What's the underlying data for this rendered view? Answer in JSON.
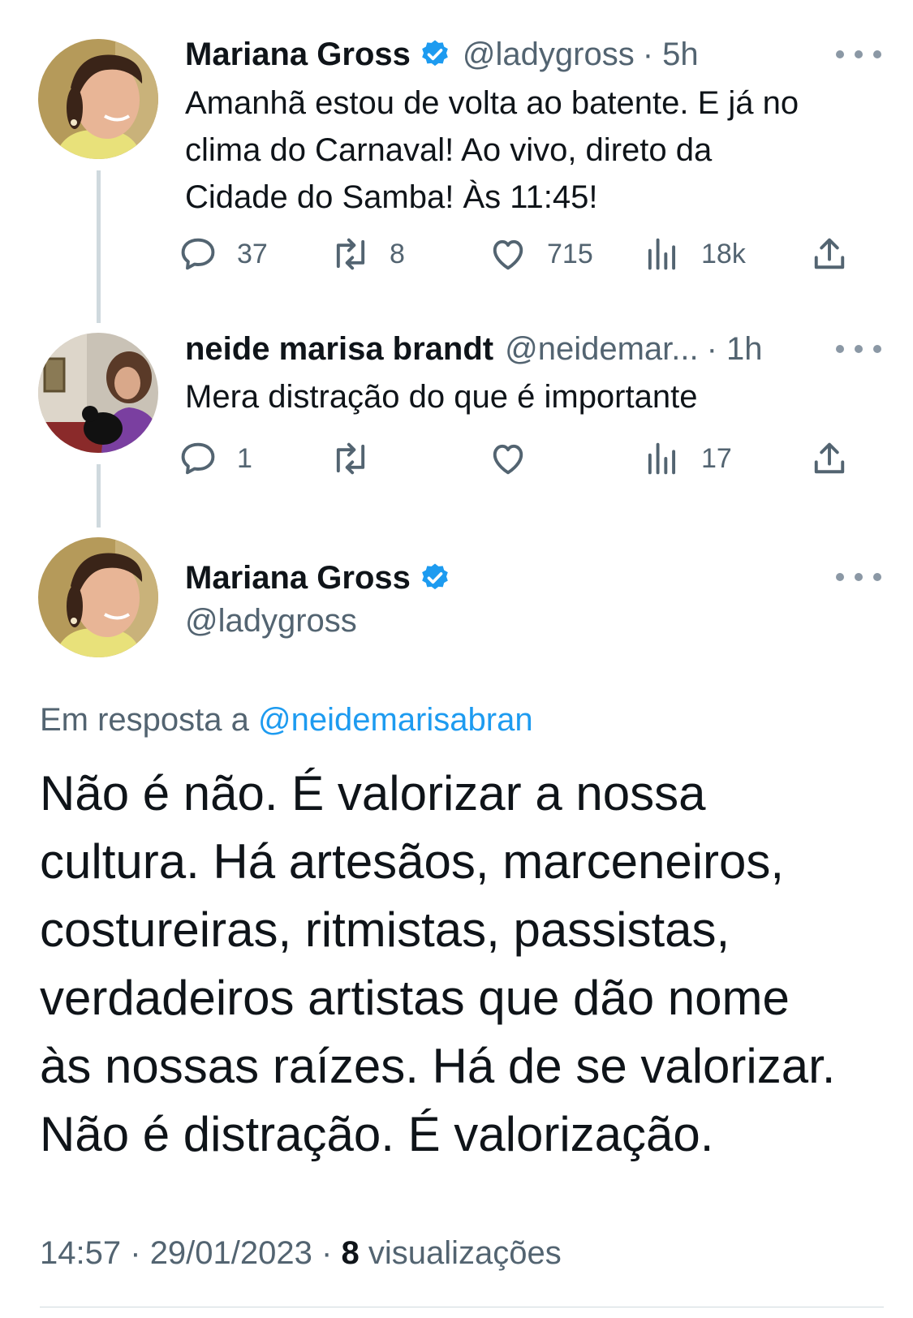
{
  "colors": {
    "accent": "#1d9bf0",
    "muted_text": "#536471",
    "thread_line": "#cfd9de"
  },
  "tweet1": {
    "author_name": "Mariana Gross",
    "handle": "@ladygross",
    "time": "· 5h",
    "text": "Amanhã estou de volta ao batente. E já no\nclima do Carnaval! Ao vivo, direto da\nCidade do Samba! Às 11:45!",
    "replies": "37",
    "retweets": "8",
    "likes": "715",
    "views": "18k",
    "avatar_icon": "avatar-photo",
    "verified_icon": "verified-badge-icon"
  },
  "tweet2": {
    "author_name": "neide marisa brandt",
    "handle": "@neidemar...",
    "time": "· 1h",
    "text": "Mera distração do que é importante",
    "replies": "1",
    "retweets": "",
    "likes": "",
    "views": "17"
  },
  "main": {
    "author_name": "Mariana Gross",
    "handle": "@ladygross",
    "reply_prefix": "Em resposta a",
    "reply_handle": "@neidemarisabran",
    "text": "Não é não. É valorizar a nossa\ncultura. Há artesãos, marceneiros,\ncostureiras, ritmistas, passistas,\nverdadeiros artistas que dão nome\nàs nossas raízes. Há de se valorizar.\nNão é distração. É valorização.",
    "time": "14:57",
    "separator": "·",
    "date": "29/01/2023",
    "views_count": "8",
    "views_label": "visualizações"
  }
}
